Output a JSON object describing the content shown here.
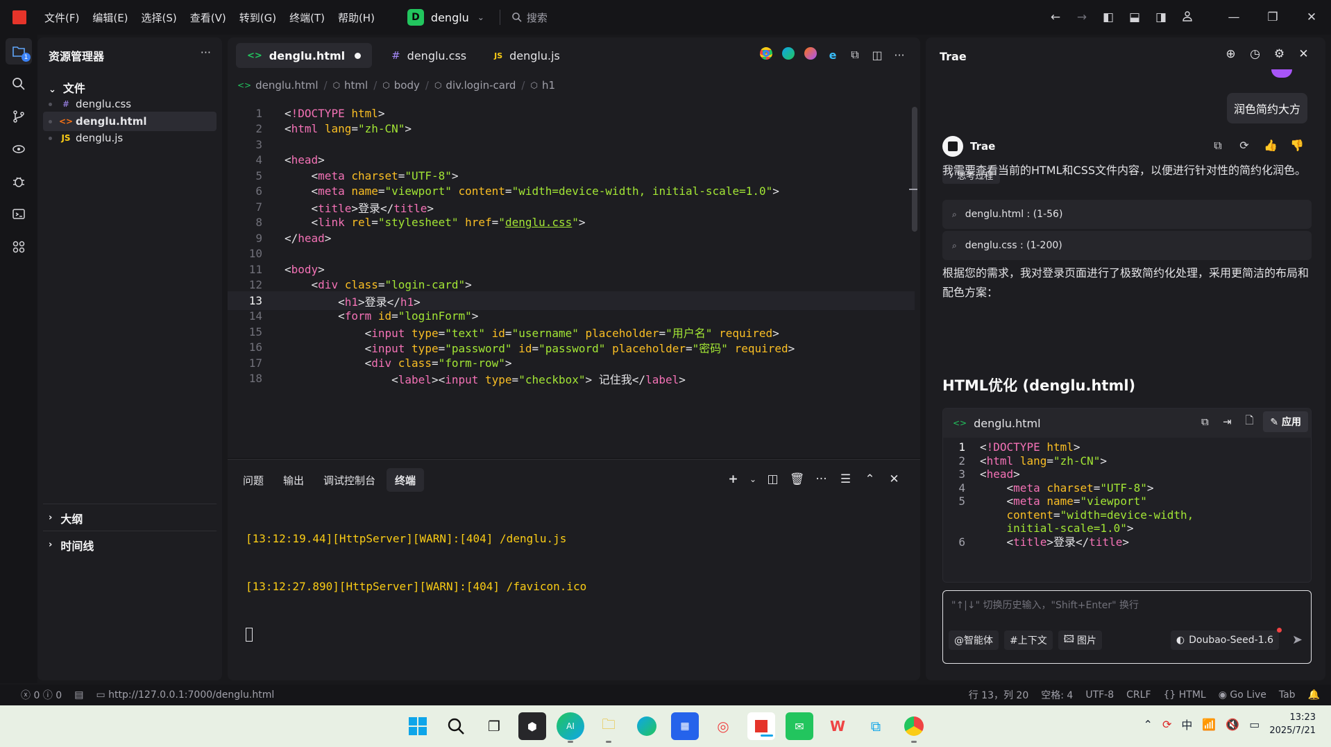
{
  "titlebar": {
    "menus": [
      "文件(F)",
      "编辑(E)",
      "选择(S)",
      "查看(V)",
      "转到(G)",
      "终端(T)",
      "帮助(H)"
    ],
    "project_badge": "D",
    "project_name": "denglu",
    "search_placeholder": "搜索"
  },
  "activity": {
    "explorer_badge": "1"
  },
  "explorer": {
    "title": "资源管理器",
    "more": "···",
    "folder": "文件",
    "files": [
      {
        "icon": "#",
        "name": "denglu.css",
        "color": "#a78bfa"
      },
      {
        "icon": "<>",
        "name": "denglu.html",
        "color": "#f97316"
      },
      {
        "icon": "JS",
        "name": "denglu.js",
        "color": "#facc15"
      }
    ],
    "outline": "大纲",
    "timeline": "时间线"
  },
  "editor": {
    "tabs": [
      {
        "icon": "<>",
        "label": "denglu.html"
      },
      {
        "icon": "#",
        "label": "denglu.css"
      },
      {
        "icon": "JS",
        "label": "denglu.js"
      }
    ],
    "breadcrumb": [
      "denglu.html",
      "html",
      "body",
      "div.login-card",
      "h1"
    ],
    "current_line": 13
  },
  "panel": {
    "tabs": [
      "问题",
      "输出",
      "调试控制台",
      "终端"
    ],
    "terminal_lines": [
      "[13:12:19.44][HttpServer][WARN]:[404] /denglu.js",
      "[13:12:27.890][HttpServer][WARN]:[404] /favicon.ico"
    ]
  },
  "chat": {
    "title": "Trae",
    "user_message": "润色简约大方",
    "bot_name": "Trae",
    "thinking_label": "思考过程",
    "para1": "我需要查看当前的HTML和CSS文件内容，以便进行针对性的简约化润色。",
    "ref1": "denglu.html : (1-56)",
    "ref2": "denglu.css : (1-200)",
    "para2": "根据您的需求，我对登录页面进行了极致简约化处理，采用更简洁的布局和配色方案：",
    "heading": "HTML优化 (denglu.html)",
    "code_file": "denglu.html",
    "apply_label": "应用",
    "input_placeholder": "\"↑|↓\" 切换历史输入，\"Shift+Enter\" 换行",
    "chip_agent": "@智能体",
    "chip_context": "#上下文",
    "chip_image": "图片",
    "model": "Doubao-Seed-1.6"
  },
  "statusbar": {
    "errors": "0",
    "warnings": "0",
    "url": "http://127.0.0.1:7000/denglu.html",
    "position": "行 13，列 20",
    "spaces": "空格: 4",
    "encoding": "UTF-8",
    "eol": "CRLF",
    "language": "HTML",
    "golive": "Go Live",
    "tab": "Tab"
  },
  "taskbar": {
    "ime": "中",
    "time": "13:23",
    "date": "2025/7/21"
  },
  "colors": {
    "accent": "#3b82f6",
    "tag": "#f472b6",
    "attr": "#fbbf24",
    "string": "#a3e635",
    "terminal_warn": "#facc15"
  }
}
